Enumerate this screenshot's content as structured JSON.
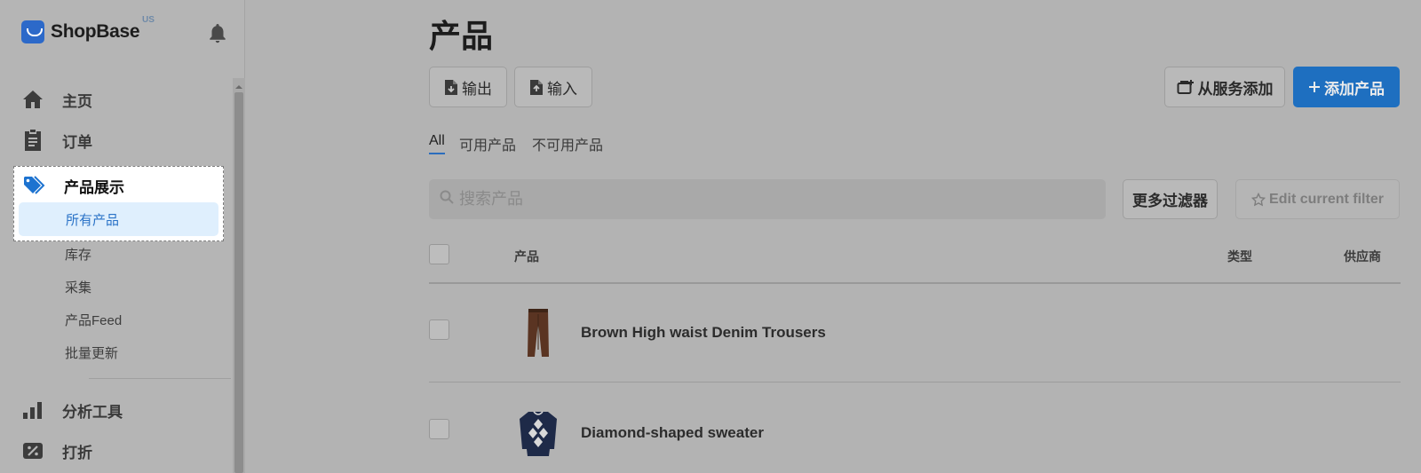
{
  "brand": {
    "name": "ShopBase",
    "region": "US"
  },
  "sidebar": {
    "nav": [
      {
        "label": "主页",
        "icon": "home-icon"
      },
      {
        "label": "订单",
        "icon": "clipboard-icon"
      },
      {
        "label": "产品展示",
        "icon": "tag-icon"
      },
      {
        "label": "分析工具",
        "icon": "bar-chart-icon"
      },
      {
        "label": "打折",
        "icon": "discount-icon"
      }
    ],
    "products_sub": [
      "所有产品",
      "库存",
      "采集",
      "产品Feed",
      "批量更新"
    ]
  },
  "main": {
    "title": "产品",
    "actions": {
      "export_label": "输出",
      "import_label": "输入",
      "from_service_label": "从服务添加",
      "add_product_label": "添加产品"
    },
    "tabs": [
      "All",
      "可用产品",
      "不可用产品"
    ],
    "search": {
      "placeholder": "搜索产品"
    },
    "more_filters_label": "更多过滤器",
    "edit_filter_label": "Edit current filter",
    "table": {
      "headers": {
        "product": "产品",
        "type": "类型",
        "vendor": "供应商"
      },
      "rows": [
        {
          "name": "Brown High waist Denim Trousers"
        },
        {
          "name": "Diamond-shaped sweater"
        }
      ]
    }
  },
  "colors": {
    "primary": "#1e6fc0",
    "selected_bg": "#dfeffd",
    "link": "#2b73c7"
  }
}
